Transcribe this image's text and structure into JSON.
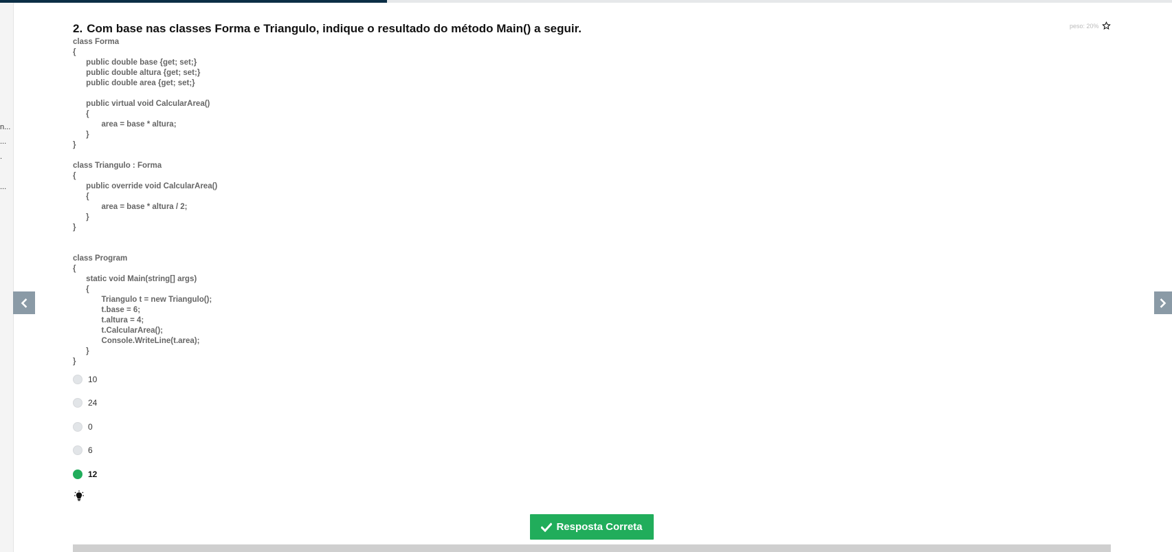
{
  "progress": {
    "fraction": 0.33,
    "fill_color": "#0b2e45",
    "track_color": "#e6e8ea"
  },
  "sidebar": {
    "truncated_items": [
      "n...",
      "...",
      ".",
      "..."
    ]
  },
  "navigation": {
    "prev_icon": "chevron-left-icon",
    "next_icon": "chevron-right-icon",
    "color": "#8a9aa6"
  },
  "question": {
    "number": "2.",
    "title": "Com base nas classes Forma e Triangulo, indique o resultado do método Main() a seguir.",
    "weight_label": "peso: 20%",
    "favorite_icon": "star-outline-icon",
    "code_lines": [
      "class Forma",
      "{",
      "      public double base {get; set;}",
      "      public double altura {get; set;}",
      "      public double area {get; set;}",
      "",
      "      public virtual void CalcularArea()",
      "      {",
      "             area = base * altura;",
      "      }",
      "}",
      "",
      "class Triangulo : Forma",
      "{",
      "      public override void CalcularArea()",
      "      {",
      "             area = base * altura / 2;",
      "      }",
      "}",
      "",
      "",
      "class Program",
      "{",
      "      static void Main(string[] args)",
      "      {",
      "             Triangulo t = new Triangulo();",
      "             t.base = 6;",
      "             t.altura = 4;",
      "             t.CalcularArea();",
      "             Console.WriteLine(t.area);",
      "      }",
      "}"
    ]
  },
  "options": [
    {
      "label": "10",
      "selected": false
    },
    {
      "label": "24",
      "selected": false
    },
    {
      "label": "0",
      "selected": false
    },
    {
      "label": "6",
      "selected": false
    },
    {
      "label": "12",
      "selected": true
    }
  ],
  "hint": {
    "icon": "lightbulb-icon"
  },
  "answer_button": {
    "label": "Resposta Correta",
    "icon": "check-icon",
    "color": "#21ad5b"
  }
}
